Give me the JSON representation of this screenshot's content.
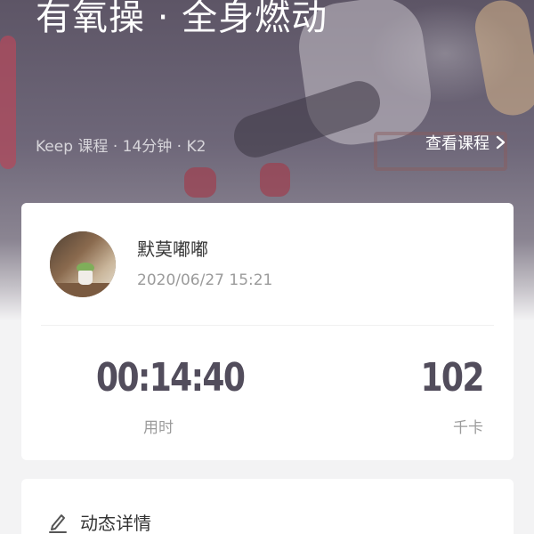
{
  "hero": {
    "title": "有氧操 · 全身燃动",
    "meta": "Keep 课程 · 14分钟 · K2",
    "link_label": "查看课程",
    "link_icon": "chevron-right-icon"
  },
  "post": {
    "user_name": "默莫嘟嘟",
    "timestamp": "2020/06/27 15:21",
    "avatar_icon": "user-avatar"
  },
  "stats": {
    "duration_value": "00:14:40",
    "duration_label": "用时",
    "calories_value": "102",
    "calories_label": "千卡"
  },
  "detail": {
    "icon": "pencil-icon",
    "title": "动态详情"
  },
  "colors": {
    "stat_text": "#524d5c",
    "muted_text": "#9b9b9b",
    "primary_text": "#333333",
    "page_bg": "#f3f3f4",
    "card_bg": "#ffffff"
  }
}
